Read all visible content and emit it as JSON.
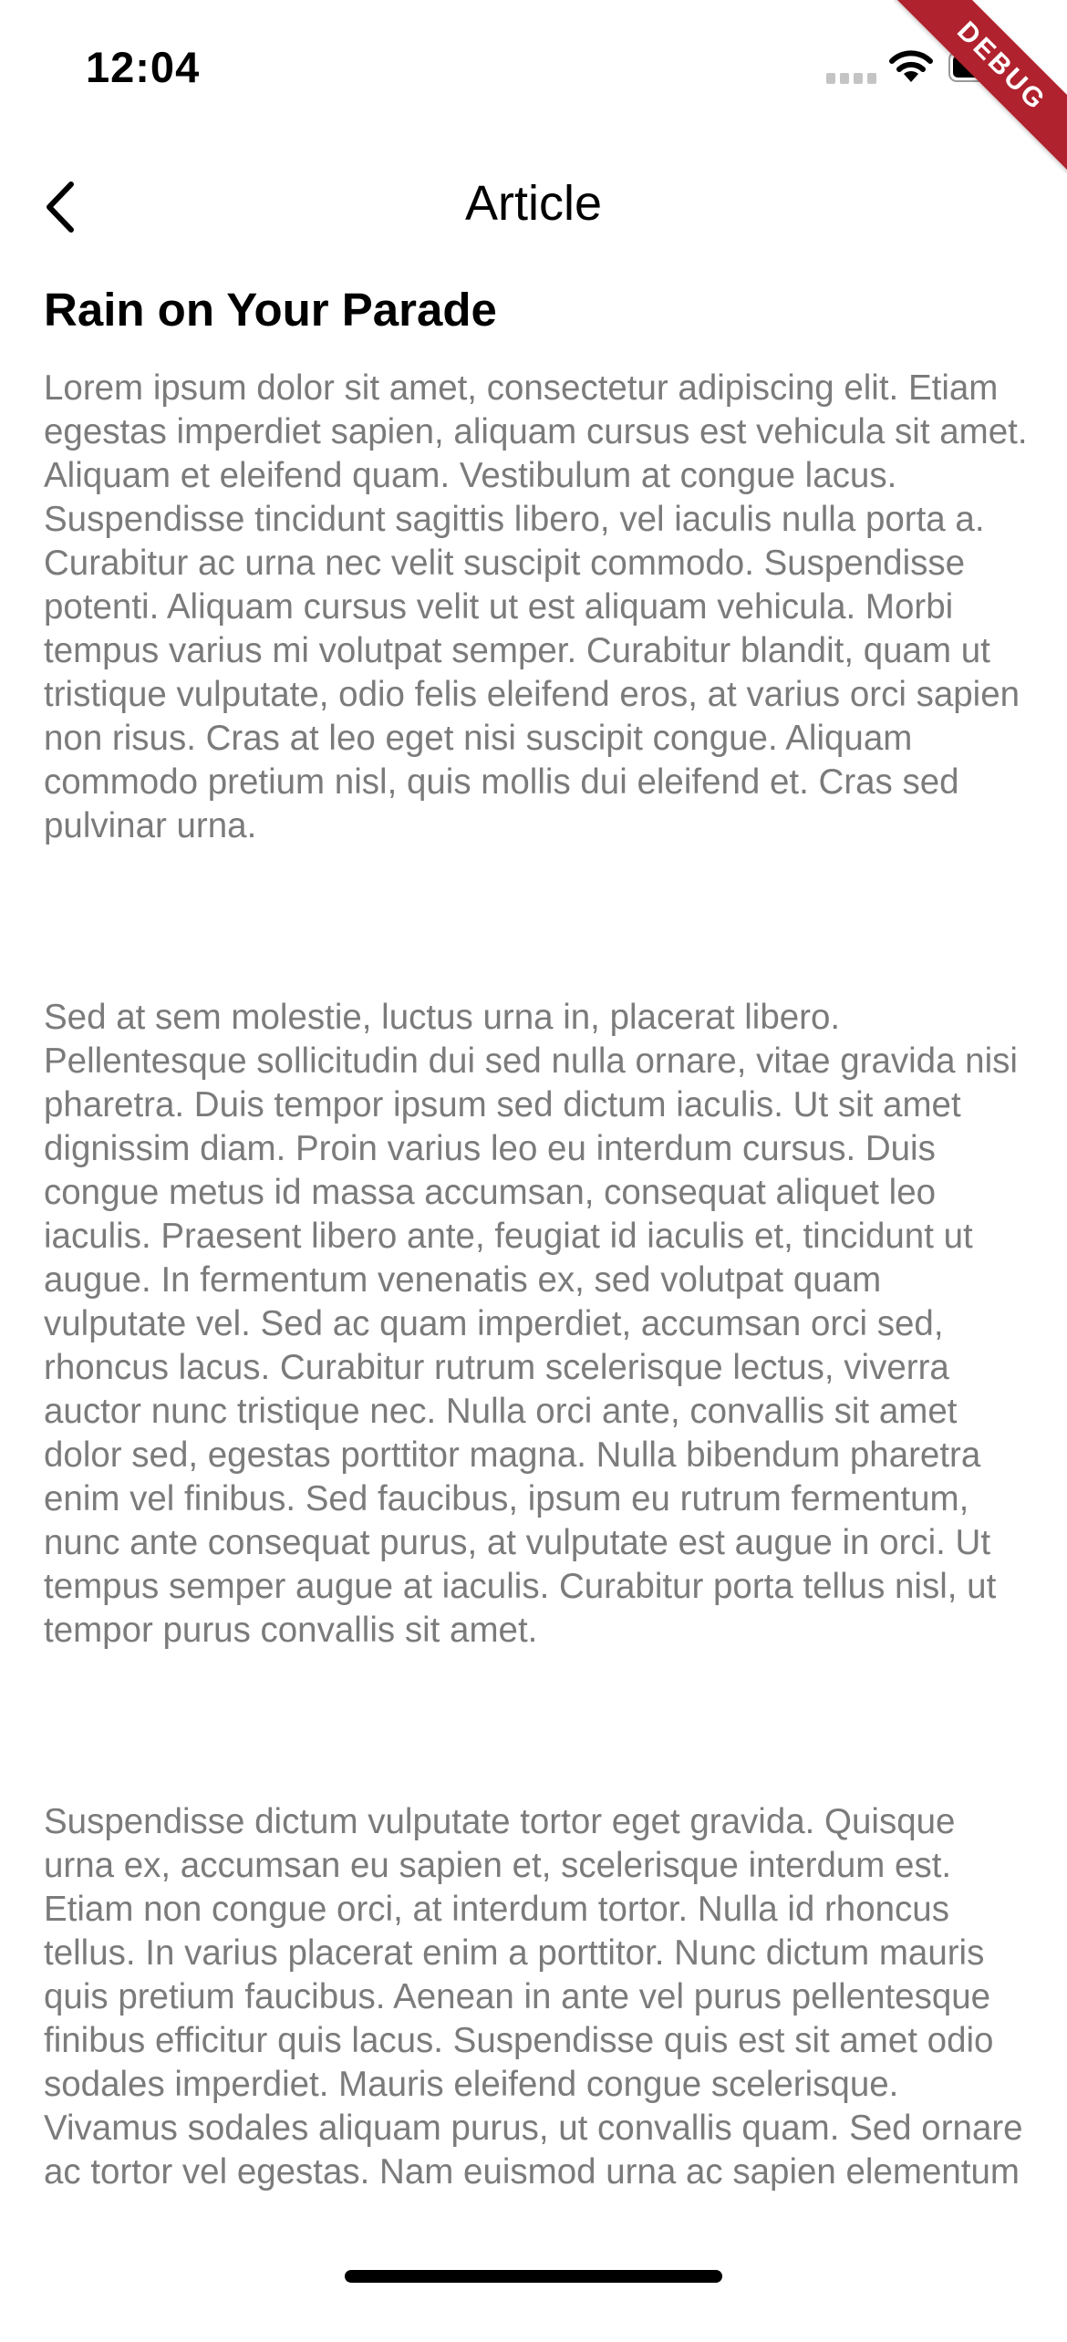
{
  "status_bar": {
    "time": "12:04"
  },
  "debug_banner": {
    "label": "DEBUG"
  },
  "app_bar": {
    "title": "Article"
  },
  "article": {
    "title": "Rain on Your Parade",
    "paragraphs": [
      "Lorem ipsum dolor sit amet, consectetur adipiscing elit. Etiam egestas imperdiet sapien, aliquam cursus est vehicula sit amet. Aliquam et eleifend quam. Vestibulum at congue lacus. Suspendisse tincidunt sagittis libero, vel iaculis nulla porta a. Curabitur ac urna nec velit suscipit commodo. Suspendisse potenti. Aliquam cursus velit ut est aliquam vehicula. Morbi tempus varius mi volutpat semper. Curabitur blandit, quam ut tristique vulputate, odio felis eleifend eros, at varius orci sapien non risus. Cras at leo eget nisi suscipit congue. Aliquam commodo pretium nisl, quis mollis dui eleifend et. Cras sed pulvinar urna.",
      "Sed at sem molestie, luctus urna in, placerat libero. Pellentesque sollicitudin dui sed nulla ornare, vitae gravida nisi pharetra. Duis tempor ipsum sed dictum iaculis. Ut sit amet dignissim diam. Proin varius leo eu interdum cursus. Duis congue metus id massa accumsan, consequat aliquet leo iaculis. Praesent libero ante, feugiat id iaculis et, tincidunt ut augue. In fermentum venenatis ex, sed volutpat quam vulputate vel. Sed ac quam imperdiet, accumsan orci sed, rhoncus lacus. Curabitur rutrum scelerisque lectus, viverra auctor nunc tristique nec. Nulla orci ante, convallis sit amet dolor sed, egestas porttitor magna. Nulla bibendum pharetra enim vel finibus. Sed faucibus, ipsum eu rutrum fermentum, nunc ante consequat purus, at vulputate est augue in orci. Ut tempus semper augue at iaculis. Curabitur porta tellus nisl, ut tempor purus convallis sit amet.",
      "Suspendisse dictum vulputate tortor eget gravida. Quisque urna ex, accumsan eu sapien et, scelerisque interdum est. Etiam non congue orci, at interdum tortor. Nulla id rhoncus tellus. In varius placerat enim a porttitor. Nunc dictum mauris quis pretium faucibus. Aenean in ante vel purus pellentesque finibus efficitur quis lacus. Suspendisse quis est sit amet odio sodales imperdiet. Mauris eleifend congue scelerisque. Vivamus sodales aliquam purus, ut convallis quam. Sed ornare ac tortor vel egestas. Nam euismod urna ac sapien elementum"
    ]
  },
  "colors": {
    "body_text": "#7b7b7b",
    "title_text": "#000000",
    "debug_banner": "#b0222e"
  },
  "icons": {
    "back": "chevron-left-icon",
    "wifi": "wifi-icon",
    "battery": "battery-icon",
    "signal": "cellular-signal-icon"
  }
}
